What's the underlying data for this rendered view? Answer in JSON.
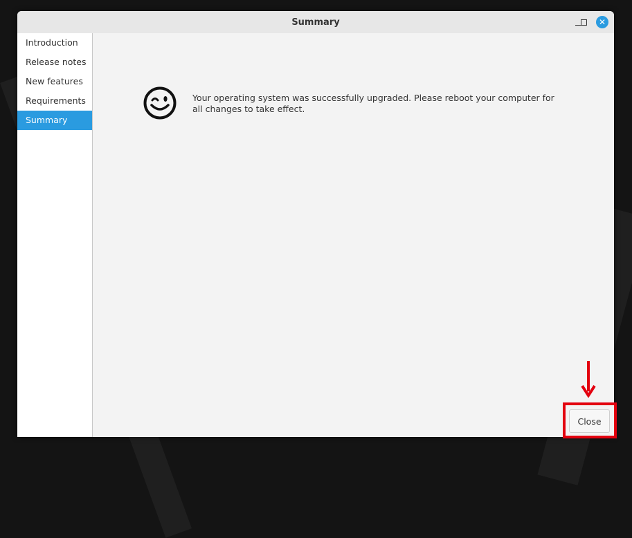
{
  "window": {
    "title": "Summary",
    "controls": {
      "minimize_icon": "minimize-icon",
      "maximize_icon": "maximize-icon",
      "close_icon": "close-icon",
      "close_glyph": "✕",
      "accent_color": "#2a9be0"
    }
  },
  "sidebar": {
    "items": [
      {
        "label": "Introduction",
        "active": false
      },
      {
        "label": "Release notes",
        "active": false
      },
      {
        "label": "New features",
        "active": false
      },
      {
        "label": "Requirements",
        "active": false
      },
      {
        "label": "Summary",
        "active": true
      }
    ],
    "active_color": "#2a9be0"
  },
  "content": {
    "icon": "wink-smiley-icon",
    "message": "Your operating system was successfully upgraded. Please reboot your computer for all changes to take effect."
  },
  "footer": {
    "close_label": "Close"
  },
  "annotation": {
    "highlight_color": "#e3000f",
    "arrow_icon": "arrow-down-icon"
  }
}
